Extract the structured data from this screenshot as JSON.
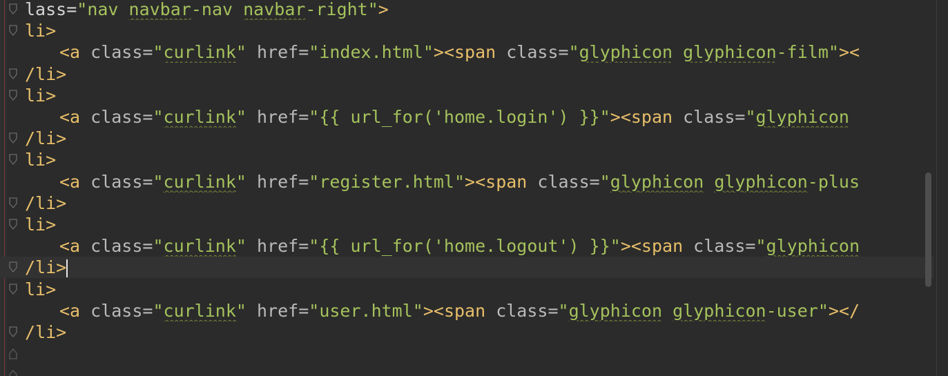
{
  "editor": {
    "caret_line_index": 12,
    "lines": [
      {
        "indent": false,
        "tokens": [
          [
            "plain",
            "lass="
          ],
          [
            "str",
            "\"nav "
          ],
          [
            "str squig",
            "navbar"
          ],
          [
            "str",
            "-nav "
          ],
          [
            "str squig",
            "navbar"
          ],
          [
            "str",
            "-right\""
          ],
          [
            "tag",
            ">"
          ]
        ]
      },
      {
        "indent": false,
        "tokens": [
          [
            "tag",
            "li>"
          ]
        ]
      },
      {
        "indent": true,
        "tokens": [
          [
            "tag",
            "<a "
          ],
          [
            "attr",
            "class="
          ],
          [
            "str",
            "\""
          ],
          [
            "str squig",
            "curlink"
          ],
          [
            "str",
            "\" "
          ],
          [
            "attr",
            "href="
          ],
          [
            "str",
            "\"index.html\""
          ],
          [
            "tag",
            "><span "
          ],
          [
            "attr",
            "class="
          ],
          [
            "str",
            "\""
          ],
          [
            "str squig",
            "glyphicon"
          ],
          [
            "str",
            " "
          ],
          [
            "str squig",
            "glyphicon"
          ],
          [
            "str",
            "-film\""
          ],
          [
            "tag",
            "><"
          ]
        ]
      },
      {
        "indent": false,
        "tokens": [
          [
            "tag",
            "/li>"
          ]
        ]
      },
      {
        "indent": false,
        "tokens": [
          [
            "tag",
            "li>"
          ]
        ]
      },
      {
        "indent": true,
        "tokens": [
          [
            "tag",
            "<a "
          ],
          [
            "attr",
            "class="
          ],
          [
            "str",
            "\""
          ],
          [
            "str squig",
            "curlink"
          ],
          [
            "str",
            "\" "
          ],
          [
            "attr",
            "href="
          ],
          [
            "str",
            "\"{{ url_for('home.login') }}\""
          ],
          [
            "tag",
            "><span "
          ],
          [
            "attr",
            "class="
          ],
          [
            "str",
            "\""
          ],
          [
            "str squig",
            "glyphicon"
          ]
        ]
      },
      {
        "indent": false,
        "tokens": [
          [
            "tag",
            "/li>"
          ]
        ]
      },
      {
        "indent": false,
        "tokens": [
          [
            "tag",
            "li>"
          ]
        ]
      },
      {
        "indent": true,
        "tokens": [
          [
            "tag",
            "<a "
          ],
          [
            "attr",
            "class="
          ],
          [
            "str",
            "\""
          ],
          [
            "str squig",
            "curlink"
          ],
          [
            "str",
            "\" "
          ],
          [
            "attr",
            "href="
          ],
          [
            "str",
            "\"register.html\""
          ],
          [
            "tag",
            "><span "
          ],
          [
            "attr",
            "class="
          ],
          [
            "str",
            "\""
          ],
          [
            "str squig",
            "glyphicon"
          ],
          [
            "str",
            " "
          ],
          [
            "str squig",
            "glyphicon"
          ],
          [
            "str",
            "-plus"
          ]
        ]
      },
      {
        "indent": false,
        "tokens": [
          [
            "tag",
            "/li>"
          ]
        ]
      },
      {
        "indent": false,
        "tokens": [
          [
            "tag",
            "li>"
          ]
        ]
      },
      {
        "indent": true,
        "tokens": [
          [
            "tag",
            "<a "
          ],
          [
            "attr",
            "class="
          ],
          [
            "str",
            "\""
          ],
          [
            "str squig",
            "curlink"
          ],
          [
            "str",
            "\" "
          ],
          [
            "attr",
            "href="
          ],
          [
            "str",
            "\"{{ url_for('home.logout') }}\""
          ],
          [
            "tag",
            "><span "
          ],
          [
            "attr",
            "class="
          ],
          [
            "str",
            "\""
          ],
          [
            "str squig",
            "glyphicon"
          ]
        ]
      },
      {
        "indent": false,
        "tokens": [
          [
            "tag",
            "/li"
          ],
          [
            "tag",
            ">"
          ]
        ]
      },
      {
        "indent": false,
        "tokens": [
          [
            "tag",
            "li>"
          ]
        ]
      },
      {
        "indent": true,
        "tokens": [
          [
            "tag",
            "<a "
          ],
          [
            "attr",
            "class="
          ],
          [
            "str",
            "\""
          ],
          [
            "str squig",
            "curlink"
          ],
          [
            "str",
            "\" "
          ],
          [
            "attr",
            "href="
          ],
          [
            "str",
            "\"user.html\""
          ],
          [
            "tag",
            "><span "
          ],
          [
            "attr",
            "class="
          ],
          [
            "str",
            "\""
          ],
          [
            "str squig",
            "glyphicon"
          ],
          [
            "str",
            " "
          ],
          [
            "str squig",
            "glyphicon"
          ],
          [
            "str",
            "-user\""
          ],
          [
            "tag",
            "></"
          ]
        ]
      },
      {
        "indent": false,
        "tokens": [
          [
            "tag",
            "/li>"
          ]
        ]
      }
    ]
  },
  "colors": {
    "background": "#2b2b2b",
    "tag": "#e8bf6a",
    "string": "#a5c25c",
    "attribute": "#bababa"
  }
}
